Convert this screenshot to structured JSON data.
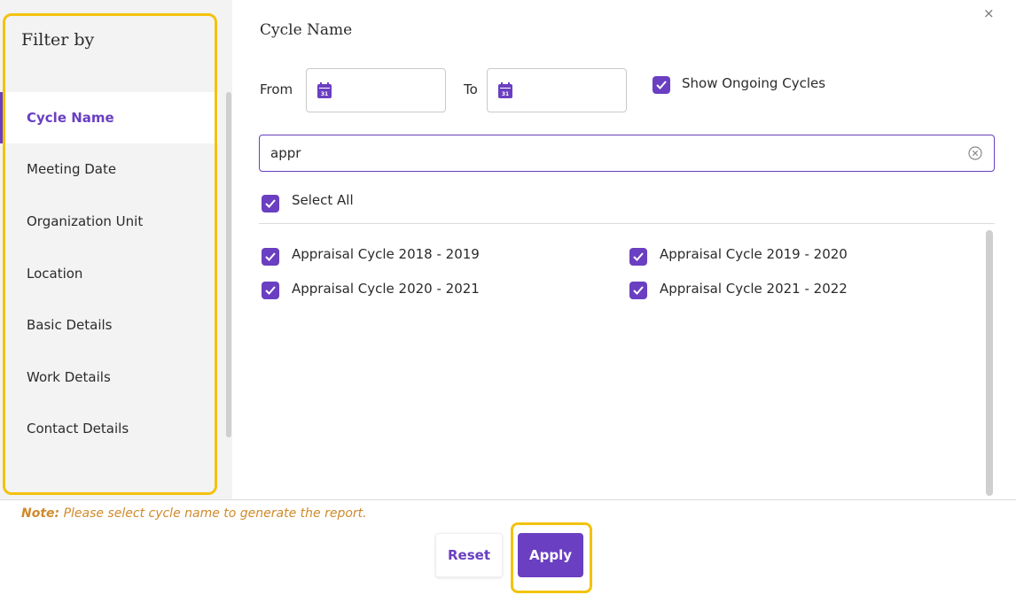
{
  "sidebar": {
    "title": "Filter by",
    "items": [
      {
        "label": "Cycle Name",
        "active": true
      },
      {
        "label": "Meeting Date",
        "active": false
      },
      {
        "label": "Organization Unit",
        "active": false
      },
      {
        "label": "Location",
        "active": false
      },
      {
        "label": "Basic Details",
        "active": false
      },
      {
        "label": "Work Details",
        "active": false
      },
      {
        "label": "Contact Details",
        "active": false
      }
    ]
  },
  "close_symbol": "×",
  "main": {
    "title": "Cycle Name",
    "from_label": "From",
    "to_label": "To",
    "calendar_icon_day": "31",
    "show_ongoing": {
      "label": "Show Ongoing Cycles",
      "checked": true
    },
    "search": {
      "value": "appr",
      "placeholder": ""
    },
    "select_all": {
      "label": "Select All",
      "checked": true
    },
    "cycles": [
      {
        "label": "Appraisal Cycle 2018 - 2019",
        "checked": true
      },
      {
        "label": "Appraisal Cycle 2019 - 2020",
        "checked": true
      },
      {
        "label": "Appraisal Cycle 2020 - 2021",
        "checked": true
      },
      {
        "label": "Appraisal Cycle 2021 - 2022",
        "checked": true
      }
    ]
  },
  "footer": {
    "note_prefix": "Note:",
    "note_text": " Please select cycle name to generate the report.",
    "reset_label": "Reset",
    "apply_label": "Apply"
  },
  "colors": {
    "accent": "#6a3fc1",
    "highlight": "#f3c20e",
    "note": "#d08a2a",
    "sidebar_bg": "#f3f3f3"
  }
}
